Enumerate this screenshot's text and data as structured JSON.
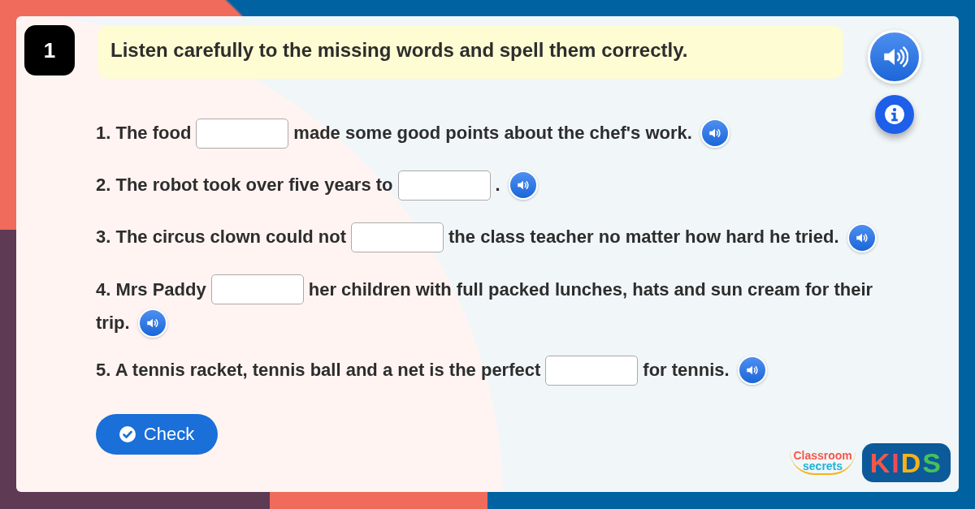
{
  "question_number": "1",
  "instruction": "Listen carefully to the missing words and spell them correctly.",
  "questions": [
    {
      "before": "1. The food",
      "after": "made some good points about the chef's work."
    },
    {
      "before": "2. The robot took over five years to",
      "after": "."
    },
    {
      "before": "3. The circus clown could not",
      "after": "the class teacher no matter how hard he tried."
    },
    {
      "before": "4. Mrs Paddy",
      "after": "her children with full packed lunches, hats and sun cream for their",
      "after_line2": "trip."
    },
    {
      "before": "5. A tennis racket, tennis ball and a net is the perfect",
      "after": "for tennis."
    }
  ],
  "check_button": "Check",
  "logo": {
    "line1": "Classroom",
    "line2": "secrets",
    "kids": "KIDS"
  }
}
